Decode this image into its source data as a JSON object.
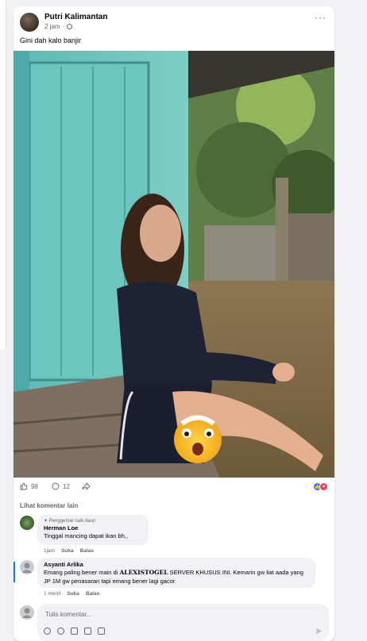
{
  "post": {
    "author": "Putri Kalimantan",
    "time": "2 jam",
    "caption": "Gini dah kalo banjir",
    "more_icon": "more-horizontal-icon",
    "reactions": {
      "likes": "98",
      "comments": "12",
      "like_color": "#1877f2",
      "love_color": "#f33e58"
    }
  },
  "comments_section": {
    "more_label": "Lihat komentar lain",
    "comments": [
      {
        "badge": "Penggemar naik daun",
        "name": "Herman Loe",
        "text": "Tinggal mancing dapat ikan bh,,",
        "time": "1jam",
        "like": "Suka",
        "reply": "Balas"
      },
      {
        "name": "Asyanti Arlika",
        "text_pre": "Emang paling bener main di ",
        "text_brand": "ALEXISTOGEL",
        "text_post": " SERVER KHUSUS INI. Kemarin gw liat aada yang JP 1M gw penasaran tapi emang bener lagi gacor",
        "time": "1 menit",
        "like": "Suka",
        "reply": "Balas"
      }
    ],
    "composer_placeholder": "Tulis komentar..."
  }
}
